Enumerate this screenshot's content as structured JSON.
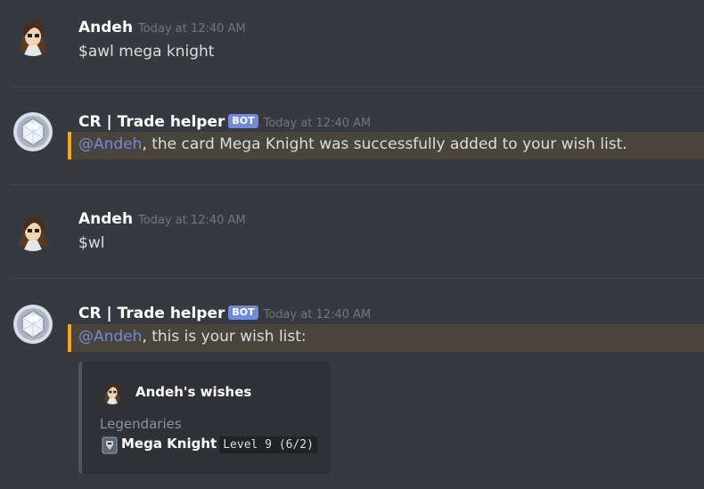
{
  "messages": [
    {
      "author": "Andeh",
      "timestamp": "Today at 12:40 AM",
      "text": "$awl mega knight"
    },
    {
      "author": "CR | Trade helper",
      "bot_tag": "BOT",
      "timestamp": "Today at 12:40 AM",
      "mention": "@Andeh",
      "text": ", the card Mega Knight was successfully added to your wish list."
    },
    {
      "author": "Andeh",
      "timestamp": "Today at 12:40 AM",
      "text": "$wl"
    },
    {
      "author": "CR | Trade helper",
      "bot_tag": "BOT",
      "timestamp": "Today at 12:40 AM",
      "mention": "@Andeh",
      "text": ", this is your wish list:",
      "embed": {
        "author": "Andeh's wishes",
        "field_name": "Legendaries",
        "card_name": "Mega Knight",
        "card_level": "Level 9 (6/2)"
      }
    }
  ],
  "colors": {
    "background": "#36393f",
    "mention": "#7289da",
    "highlight_bar": "#faa61a",
    "bot_tag": "#7289da"
  },
  "icons": {
    "user_avatar": "anime-character-avatar",
    "bot_avatar": "silver-gem-avatar",
    "card_icon": "mega-knight-card-icon"
  }
}
